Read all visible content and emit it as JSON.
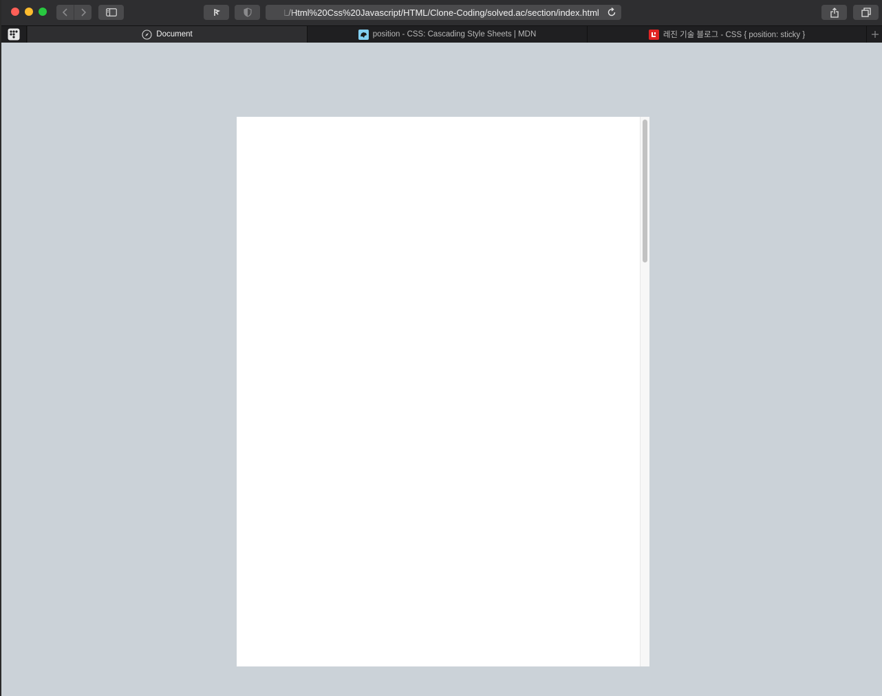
{
  "browser": {
    "url": "L/Html%20Css%20Javascript/HTML/Clone-Coding/solved.ac/section/index.html",
    "icons": {
      "back": "chevron-left-icon",
      "forward": "chevron-right-icon",
      "sidebar": "sidebar-icon",
      "extension": "extension-icon",
      "privacy": "shield-icon",
      "reload": "reload-icon",
      "share": "share-icon",
      "tabs": "tab-overview-icon",
      "new_tab": "plus-icon"
    }
  },
  "tabs": [
    {
      "title": "Document",
      "active": true,
      "favicon": "compass-icon"
    },
    {
      "title": "position - CSS: Cascading Style Sheets | MDN",
      "active": false,
      "favicon": "mdn-icon",
      "favicon_color": "#83d0f2"
    },
    {
      "title": "레진 기술 블로그 - CSS { position: sticky }",
      "active": false,
      "favicon": "lezhin-icon",
      "favicon_color": "#e02424"
    }
  ],
  "colors": {
    "page_background": "#cbd2d8",
    "frame_background": "#ffffff",
    "toolbar": "#2e2e30"
  }
}
